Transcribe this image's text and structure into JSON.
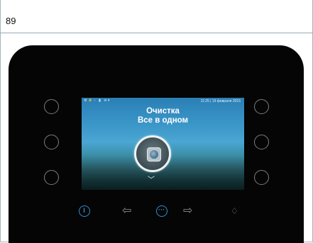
{
  "page": {
    "number": "89",
    "corner_text": ""
  },
  "device": {
    "left_buttons": [
      "left-button-1",
      "left-button-2",
      "left-button-3"
    ],
    "right_buttons": [
      "right-button-1",
      "right-button-2",
      "right-button-3"
    ],
    "controls": {
      "power_icon": "power-icon",
      "back_arrow_icon": "arrow-left-icon",
      "menu_icon": "more-dots-icon",
      "menu_label": "···",
      "power_label": "I",
      "forward_arrow_icon": "arrow-right-icon",
      "drop_icon": "water-drop-icon"
    },
    "colors": {
      "accent": "#2e8fd0",
      "body": "#050505",
      "button_ring": "#7d7d7d"
    }
  },
  "screen": {
    "status_icons": "⚙⚡◌ ▮ ≋▾",
    "clock": "11:25 | 19 февраля 2015",
    "title_line1": "Очистка",
    "title_line2": "Все в одном",
    "selector_icon": "cleaning-program-icon",
    "scroll_hint": "﹀"
  }
}
